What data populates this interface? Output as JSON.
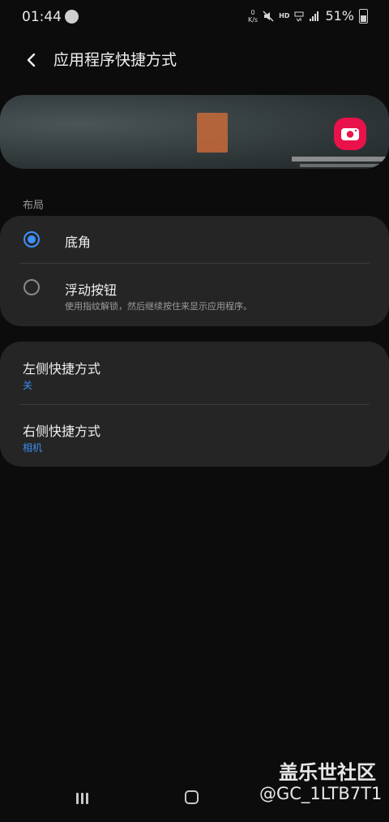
{
  "status_bar": {
    "time": "01:44",
    "net_speed_value": "0",
    "net_speed_unit": "K/s",
    "hd": "HD",
    "battery_percent": "51%"
  },
  "header": {
    "title": "应用程序快捷方式"
  },
  "layout_section": {
    "label": "布局",
    "options": [
      {
        "title": "底角",
        "selected": true
      },
      {
        "title": "浮动按钮",
        "subtitle": "使用指纹解锁，然后继续按住来显示应用程序。",
        "selected": false
      }
    ]
  },
  "shortcuts": [
    {
      "title": "左侧快捷方式",
      "value": "关"
    },
    {
      "title": "右侧快捷方式",
      "value": "相机"
    }
  ],
  "watermark": {
    "title": "盖乐世社区",
    "user": "@GC_1LTB7T1"
  },
  "colors": {
    "accent": "#3e91ff",
    "camera_button": "#e9124a"
  }
}
